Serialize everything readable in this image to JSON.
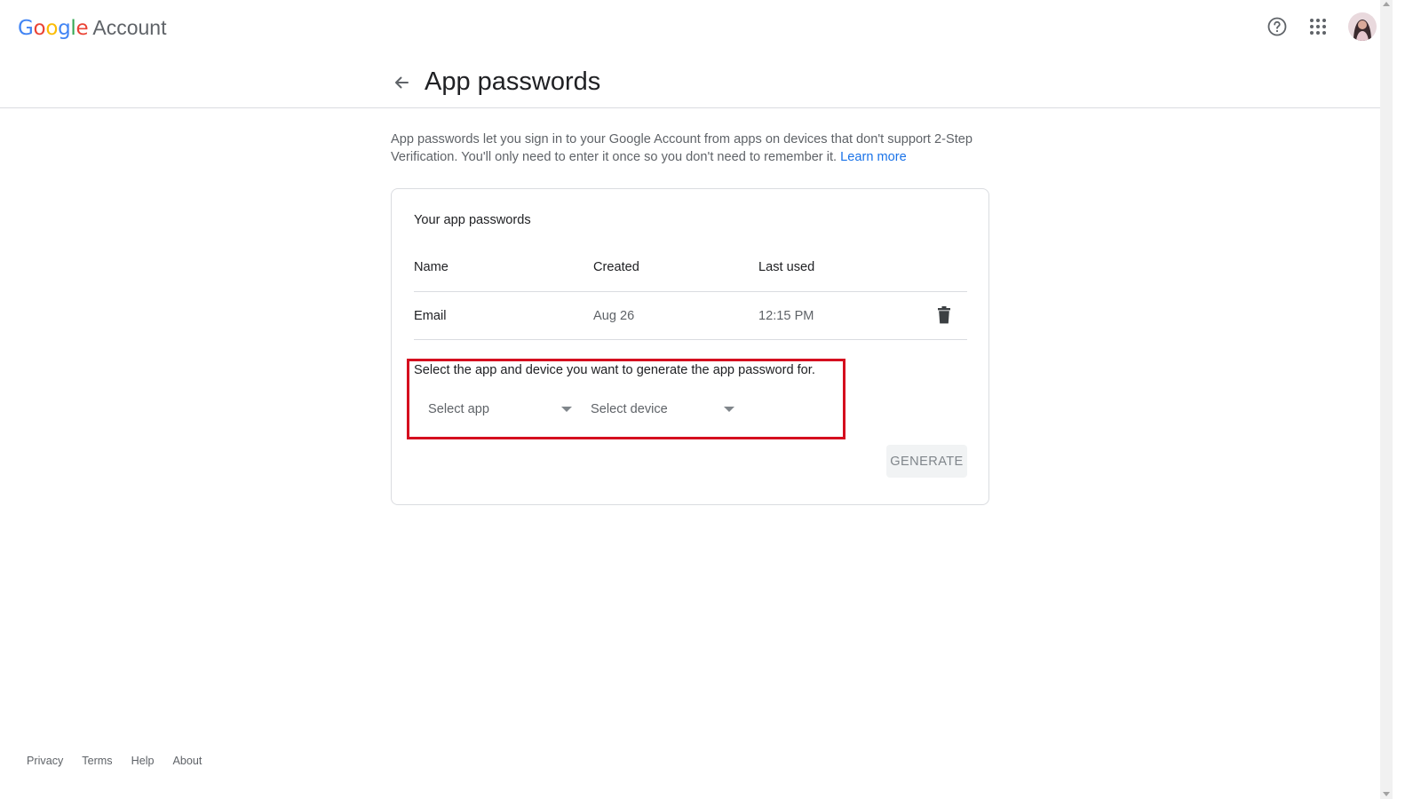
{
  "brand": {
    "logo_letters": [
      {
        "ch": "G",
        "color": "#4285F4"
      },
      {
        "ch": "o",
        "color": "#EA4335"
      },
      {
        "ch": "o",
        "color": "#FBBC05"
      },
      {
        "ch": "g",
        "color": "#4285F4"
      },
      {
        "ch": "l",
        "color": "#34A853"
      },
      {
        "ch": "e",
        "color": "#EA4335"
      }
    ],
    "logo_text": "Google",
    "product": "Account"
  },
  "header": {
    "icons": [
      "help-icon",
      "apps-grid-icon",
      "avatar"
    ]
  },
  "page": {
    "title": "App passwords",
    "intro": "App passwords let you sign in to your Google Account from apps on devices that don't support 2-Step Verification. You'll only need to enter it once so you don't need to remember it.",
    "learn_more": "Learn more"
  },
  "card": {
    "title": "Your app passwords",
    "columns": [
      "Name",
      "Created",
      "Last used"
    ],
    "rows": [
      {
        "name": "Email",
        "created": "Aug 26",
        "last_used": "12:15 PM"
      }
    ],
    "select_prompt": "Select the app and device you want to generate the app password for.",
    "select_app": "Select app",
    "select_device": "Select device",
    "generate": "GENERATE"
  },
  "footer": {
    "links": [
      "Privacy",
      "Terms",
      "Help",
      "About"
    ]
  },
  "colors": {
    "accent": "#1a73e8",
    "highlight": "#d50f1f"
  }
}
